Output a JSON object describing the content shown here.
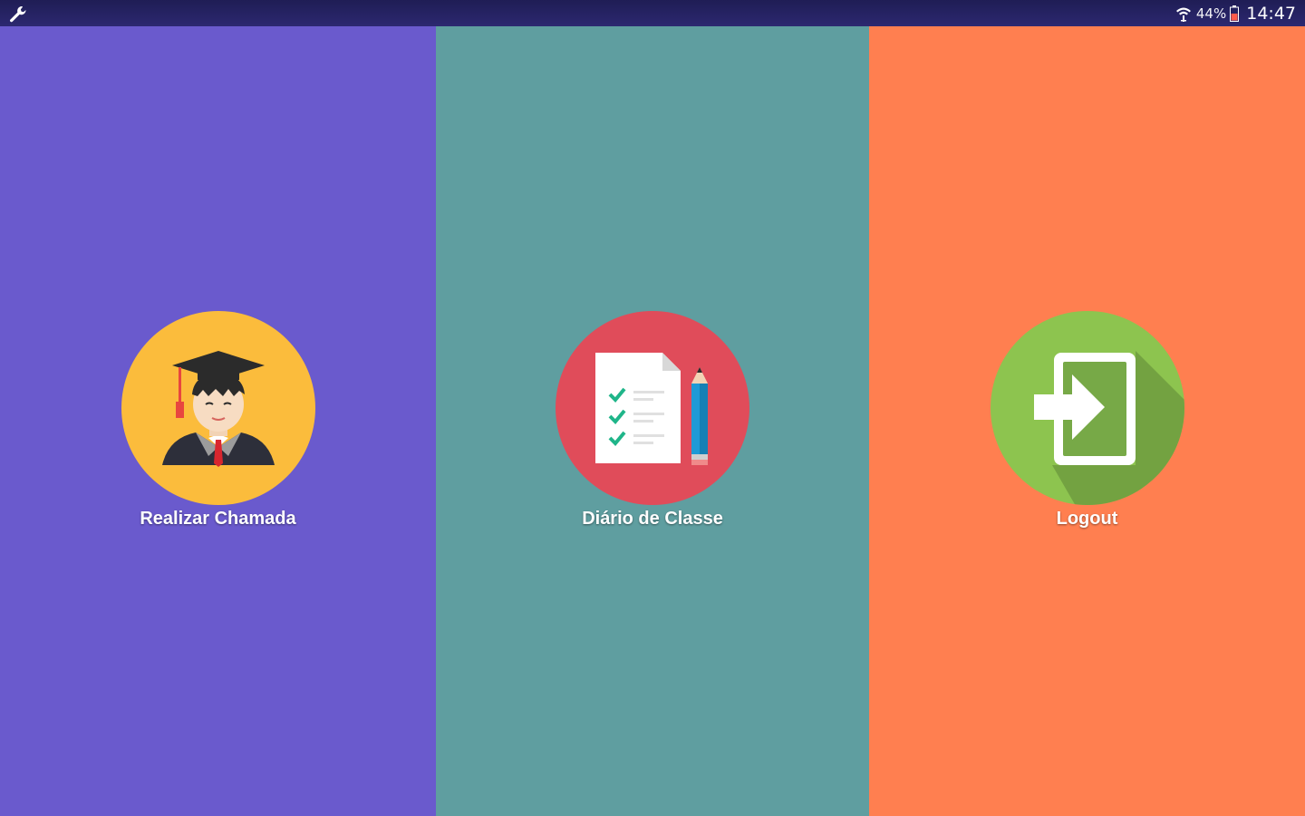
{
  "status_bar": {
    "battery_percent": "44%",
    "time": "14:47",
    "icons": [
      "wrench-icon",
      "wifi-icon",
      "battery-icon"
    ]
  },
  "menu": {
    "items": [
      {
        "label": "Realizar Chamada",
        "icon": "graduate-student-icon",
        "color": "#6a5acd",
        "circle_color": "#fbbc3c"
      },
      {
        "label": "Diário de Classe",
        "icon": "class-diary-icon",
        "color": "#5f9ea0",
        "circle_color": "#e04c5a"
      },
      {
        "label": "Logout",
        "icon": "logout-icon",
        "color": "#ff7f50",
        "circle_color": "#8dc44f"
      }
    ]
  }
}
